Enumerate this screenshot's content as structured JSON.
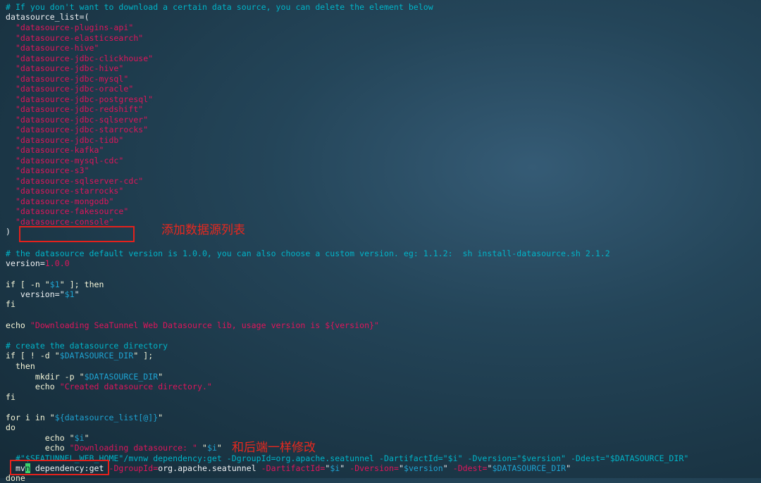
{
  "terminal": {
    "comment_download": "# If you don't want to download a certain data source, you can delete the element below",
    "list_decl": "datasource_list=(",
    "datasource_items": [
      "\"datasource-plugins-api\"",
      "\"datasource-elasticsearch\"",
      "\"datasource-hive\"",
      "\"datasource-jdbc-clickhouse\"",
      "\"datasource-jdbc-hive\"",
      "\"datasource-jdbc-mysql\"",
      "\"datasource-jdbc-oracle\"",
      "\"datasource-jdbc-postgresql\"",
      "\"datasource-jdbc-redshift\"",
      "\"datasource-jdbc-sqlserver\"",
      "\"datasource-jdbc-starrocks\"",
      "\"datasource-jdbc-tidb\"",
      "\"datasource-kafka\"",
      "\"datasource-mysql-cdc\"",
      "\"datasource-s3\"",
      "\"datasource-sqlserver-cdc\"",
      "\"datasource-starrocks\"",
      "\"datasource-mongodb\"",
      "\"datasource-fakesource\"",
      "\"datasource-console\""
    ],
    "list_close": ")",
    "comment_version": "# the datasource default version is 1.0.0, you can also choose a custom version. eg: 1.1.2:  sh install-datasource.sh 2.1.2",
    "version_key": "version=",
    "version_value": "1.0.0",
    "if_kw": "if [ -n ",
    "if_q1": "\"",
    "if_var": "$1",
    "if_q2": "\"",
    "if_rest": " ]; then",
    "assign_key": "   version=",
    "assign_q1": "\"",
    "assign_var": "$1",
    "assign_q2": "\"",
    "fi1": "fi",
    "echo_kw": "echo ",
    "echo_str": "\"Downloading SeaTunnel Web Datasource lib, usage version is ${version}\"",
    "comment_dir": "# create the datasource directory",
    "if2_kw": "if [ ! -d ",
    "if2_q1": "\"",
    "if2_var": "$DATASOURCE_DIR",
    "if2_q2": "\"",
    "if2_rest": " ];",
    "then2": "  then",
    "mkdir_kw": "      mkdir -p ",
    "mkdir_q1": "\"",
    "mkdir_var": "$DATASOURCE_DIR",
    "mkdir_q2": "\"",
    "echo2_kw": "      echo ",
    "echo2_str": "\"Created datasource directory.\"",
    "fi2": "fi",
    "for_kw": "for i in ",
    "for_q1": "\"",
    "for_var": "${datasource_list[@]}",
    "for_q2": "\"",
    "do_kw": "do",
    "echo3_kw": "        echo ",
    "echo3_q1": "\"",
    "echo3_var": "$i",
    "echo3_q2": "\"",
    "echo4_kw": "        echo ",
    "echo4_str": "\"Downloading datasource: \"",
    "echo4_sp": " ",
    "echo4_q1": "\"",
    "echo4_var": "$i",
    "echo4_q2": "\"",
    "mvnw_comment": "  #\"$SEATUNNEL_WEB_HOME\"/mvnw dependency:get -DgroupId=org.apache.seatunnel -DartifactId=\"$i\" -Dversion=\"$version\" -Ddest=\"$DATASOURCE_DIR\"",
    "mvn_pre": "  mv",
    "mvn_cursor": "n",
    "mvn_mid": " dependency:get ",
    "mvn_dg": "-DgroupId=",
    "mvn_org": "org.apache.seatunnel ",
    "mvn_da": "-DartifactId=",
    "mvn_q1": "\"",
    "mvn_i": "$i",
    "mvn_q2": "\" ",
    "mvn_dv": "-Dversion=",
    "mvn_q3": "\"",
    "mvn_ver": "$version",
    "mvn_q4": "\" ",
    "mvn_dd": "-Ddest=",
    "mvn_q5": "\"",
    "mvn_dir": "$DATASOURCE_DIR",
    "mvn_q6": "\"",
    "done_kw": "done"
  },
  "annotations": {
    "add_list": "添加数据源列表",
    "same_as_backend": "和后端一样修改"
  },
  "colors": {
    "comment": "#00b4c8",
    "string": "#e0155b",
    "variable": "#1ea3d2",
    "text": "#f0f2f4",
    "annotation": "#e4211c"
  }
}
